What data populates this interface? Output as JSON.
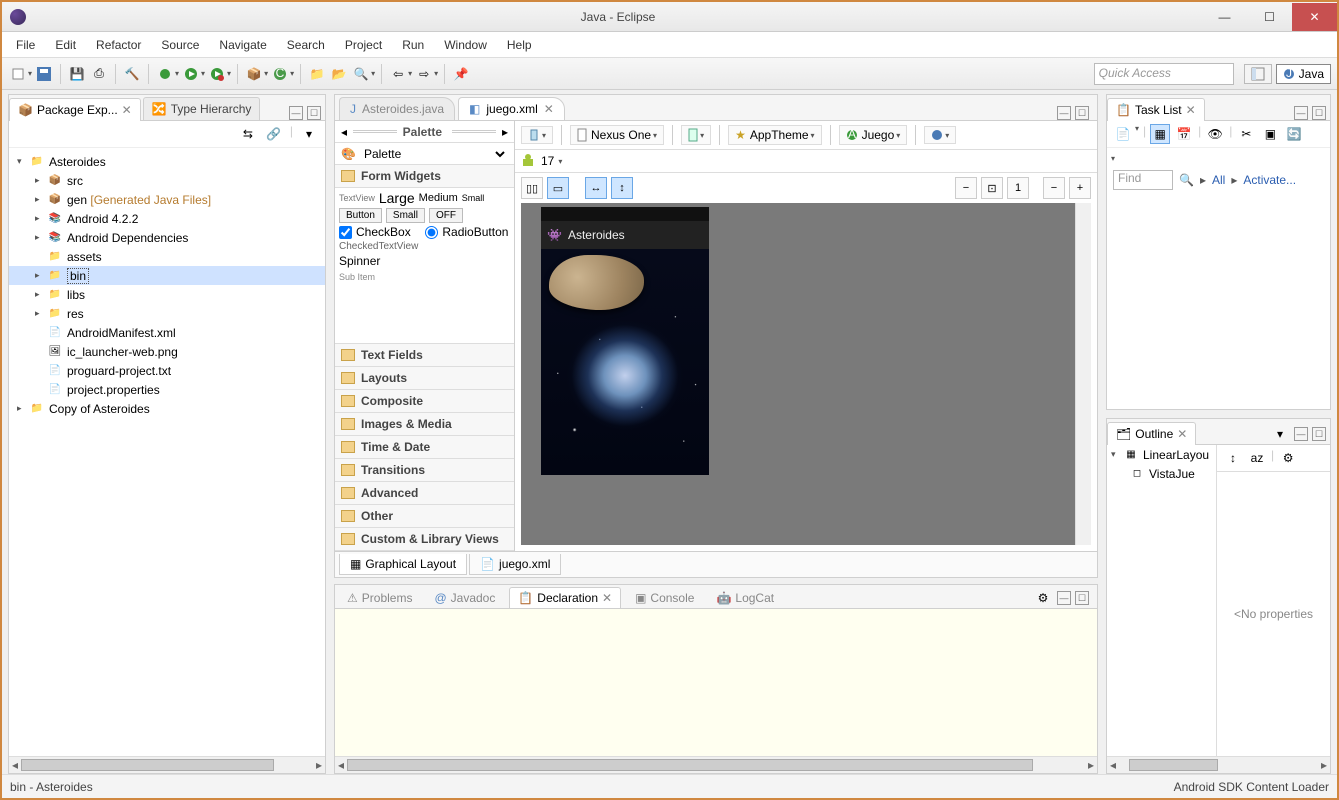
{
  "window": {
    "title": "Java - Eclipse"
  },
  "menu": [
    "File",
    "Edit",
    "Refactor",
    "Source",
    "Navigate",
    "Search",
    "Project",
    "Run",
    "Window",
    "Help"
  ],
  "quick_access": "Quick Access",
  "perspective": {
    "label": "Java"
  },
  "left": {
    "tabs": {
      "pkg": "Package Exp...",
      "hier": "Type Hierarchy"
    },
    "tree": {
      "root": "Asteroides",
      "src": "src",
      "gen": "gen",
      "gen_note": "[Generated Java Files]",
      "android": "Android 4.2.2",
      "deps": "Android Dependencies",
      "assets": "assets",
      "bin": "bin",
      "libs": "libs",
      "res": "res",
      "manifest": "AndroidManifest.xml",
      "launcher": "ic_launcher-web.png",
      "proguard": "proguard-project.txt",
      "props": "project.properties",
      "copy": "Copy of Asteroides"
    }
  },
  "editor": {
    "tabs": {
      "inactive": "Asteroides.java",
      "active": "juego.xml"
    },
    "palette": {
      "title": "Palette",
      "filter": "Palette",
      "form_widgets": "Form Widgets",
      "row_tv": "TextView",
      "row_lg": "Large",
      "row_md": "Medium",
      "row_sm": "Small",
      "btn": "Button",
      "btn_sm": "Small",
      "btn_off": "OFF",
      "cb": "CheckBox",
      "rb": "RadioButton",
      "ctv": "CheckedTextView",
      "sp": "Spinner",
      "sp_sub": "Sub Item",
      "cats": [
        "Text Fields",
        "Layouts",
        "Composite",
        "Images & Media",
        "Time & Date",
        "Transitions",
        "Advanced",
        "Other",
        "Custom & Library Views"
      ]
    },
    "design": {
      "device": "Nexus One",
      "theme": "AppTheme",
      "activity": "Juego",
      "api": "17"
    },
    "app": {
      "name": "Asteroides"
    },
    "bottom_tabs": {
      "graphical": "Graphical Layout",
      "xml": "juego.xml"
    }
  },
  "tasks": {
    "title": "Task List",
    "find": "Find",
    "all": "All",
    "activate": "Activate..."
  },
  "outline": {
    "title": "Outline",
    "root": "LinearLayou",
    "child": "VistaJue",
    "empty": "<No properties"
  },
  "bottom": {
    "tabs": {
      "problems": "Problems",
      "javadoc": "Javadoc",
      "decl": "Declaration",
      "console": "Console",
      "logcat": "LogCat"
    }
  },
  "status": {
    "left": "bin - Asteroides",
    "right": "Android SDK Content Loader"
  }
}
